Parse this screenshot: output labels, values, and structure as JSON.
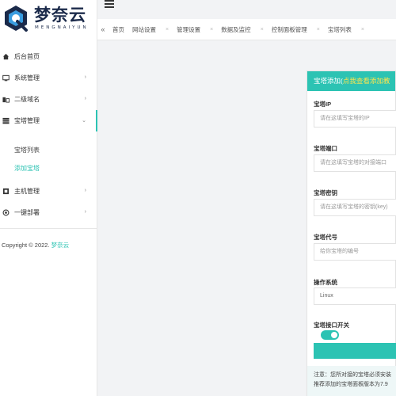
{
  "brand": {
    "name": "梦奈云",
    "subtitle": "MENGNAIYUN"
  },
  "colors": {
    "accent": "#2cc3b3",
    "header_highlight": "#ffe44d",
    "navy": "#1b2a4a"
  },
  "sidebar": {
    "items": [
      {
        "label": "后台首页",
        "icon": "home-icon"
      },
      {
        "label": "系统管理",
        "icon": "system-icon"
      },
      {
        "label": "二级域名",
        "icon": "domain-icon"
      },
      {
        "label": "宝塔管理",
        "icon": "server-icon"
      },
      {
        "label": "主机管理",
        "icon": "host-icon"
      },
      {
        "label": "一键部署",
        "icon": "deploy-icon"
      }
    ],
    "submenu": [
      {
        "label": "宝塔列表"
      },
      {
        "label": "添加宝塔"
      }
    ],
    "copyright_prefix": "Copyright © 2022.",
    "copyright_brand": "梦奈云"
  },
  "tabs": [
    {
      "label": "首页"
    },
    {
      "label": "网站设置"
    },
    {
      "label": "管理设置"
    },
    {
      "label": "数据及监控"
    },
    {
      "label": "控制面板管理"
    },
    {
      "label": "宝塔列表"
    }
  ],
  "form": {
    "header_prefix": "宝塔添加(",
    "header_highlight": "点我查看添加教",
    "fields": [
      {
        "label": "宝塔IP",
        "placeholder": "请在这填写宝塔的IP"
      },
      {
        "label": "宝塔端口",
        "placeholder": "请在这填写宝塔的对接端口"
      },
      {
        "label": "宝塔密钥",
        "placeholder": "请在这填写宝塔的密钥(key)"
      },
      {
        "label": "宝塔代号",
        "placeholder": "给你宝塔的编号"
      },
      {
        "label": "操作系统",
        "value": "Linux"
      }
    ],
    "switch_label": "宝塔接口开关",
    "switch_on": true,
    "notice_line1": "注意：您所对接的宝塔必须安装",
    "notice_line2": "推荐添加的宝塔面板版本为7.9"
  }
}
